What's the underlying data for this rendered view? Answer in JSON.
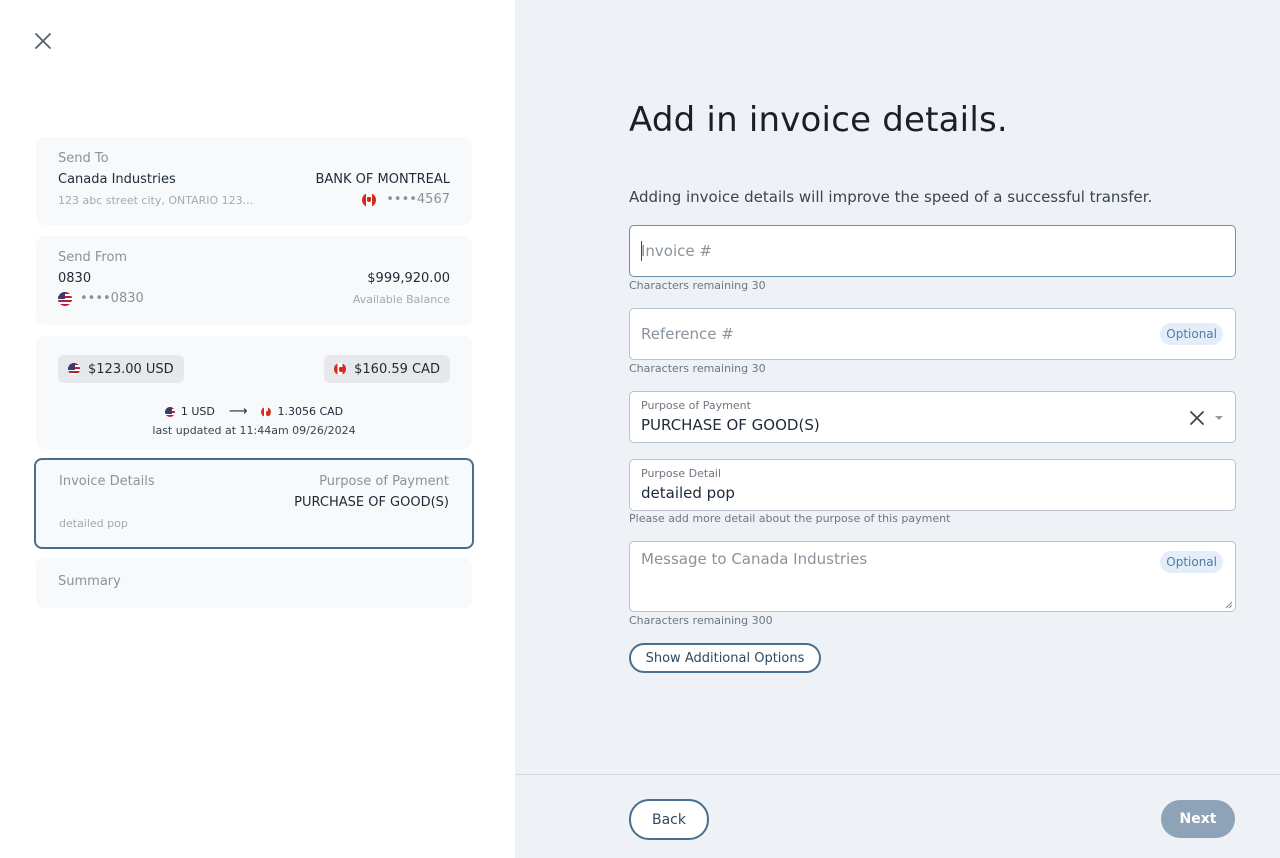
{
  "send_to": {
    "label": "Send To",
    "name": "Canada Industries",
    "address": "123 abc street city, ONTARIO 123...",
    "bank": "BANK OF MONTREAL",
    "account": "••••4567"
  },
  "send_from": {
    "label": "Send From",
    "name": "0830",
    "account": "••••0830",
    "balance": "$999,920.00",
    "balance_label": "Available Balance"
  },
  "conversion": {
    "from_amount": "$123.00 USD",
    "to_amount": "$160.59 CAD",
    "rate_from": "1 USD",
    "rate_to": "1.3056 CAD",
    "updated": "last updated at 11:44am 09/26/2024"
  },
  "invoice_card": {
    "label": "Invoice Details",
    "detail": "detailed pop",
    "purpose_label": "Purpose of Payment",
    "purpose_value": "PURCHASE OF GOOD(S)"
  },
  "summary": {
    "label": "Summary"
  },
  "form": {
    "title": "Add in invoice details.",
    "subtitle": "Adding invoice details will improve the speed of a successful transfer.",
    "invoice_placeholder": "Invoice #",
    "invoice_helper": "Characters remaining 30",
    "reference_placeholder": "Reference #",
    "reference_helper": "Characters remaining 30",
    "optional": "Optional",
    "purpose_label": "Purpose of Payment",
    "purpose_value": "PURCHASE OF GOOD(S)",
    "detail_label": "Purpose Detail",
    "detail_value": "detailed pop",
    "detail_helper": "Please add more detail about the purpose of this payment",
    "message_placeholder": "Message to Canada Industries",
    "message_helper": "Characters remaining 300",
    "additional_options": "Show Additional Options"
  },
  "footer": {
    "back": "Back",
    "next": "Next"
  },
  "colors": {
    "accent": "#4a6e8e",
    "panel_bg": "#eef2f6",
    "next_disabled": "#8fa3b8"
  }
}
